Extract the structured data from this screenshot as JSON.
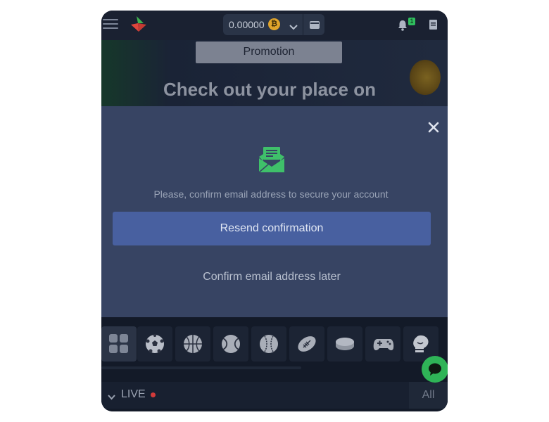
{
  "header": {
    "menu_icon": "hamburger-icon",
    "logo_icon": "brand-logo-icon",
    "balance": "0.00000",
    "currency_icon": "bitcoin-icon",
    "currency_symbol": "₿",
    "notification_count": "1"
  },
  "banner": {
    "promo_label": "Promotion",
    "title": "Check out your place on"
  },
  "modal": {
    "icon": "email-icon",
    "message": "Please, confirm email address to secure your account",
    "resend_label": "Resend confirmation",
    "later_label": "Confirm email address later"
  },
  "sports": [
    {
      "icon": "all-sports-grid-icon"
    },
    {
      "icon": "soccer-ball-icon"
    },
    {
      "icon": "basketball-icon"
    },
    {
      "icon": "tennis-ball-icon"
    },
    {
      "icon": "baseball-icon"
    },
    {
      "icon": "american-football-icon"
    },
    {
      "icon": "hockey-puck-icon"
    },
    {
      "icon": "gamepad-icon"
    },
    {
      "icon": "boxing-glove-icon"
    }
  ],
  "live": {
    "label": "LIVE",
    "all_label": "All"
  },
  "colors": {
    "accent_green": "#2fb457",
    "modal_bg": "#374463",
    "button_blue": "#4860a0",
    "live_red": "#d23a3a"
  }
}
